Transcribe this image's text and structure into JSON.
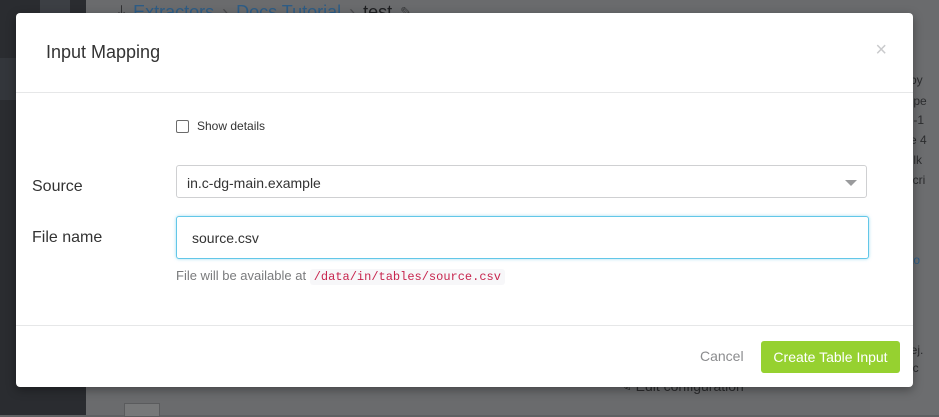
{
  "background": {
    "breadcrumb": [
      "Extractors",
      "Docs Tutorial",
      "test"
    ],
    "right_panel_fragments": [
      "d by",
      "pope",
      "02-1",
      "ate 4",
      "pelk",
      "escri",
      "e to",
      "ns",
      "drej.",
      "sec"
    ],
    "edit_configuration": "Edit configuration"
  },
  "modal": {
    "title": "Input Mapping",
    "close_glyph": "×",
    "show_details_label": "Show details",
    "show_details_checked": false,
    "source": {
      "label": "Source",
      "selected": "in.c-dg-main.example"
    },
    "file_name": {
      "label": "File name",
      "value": "source.csv"
    },
    "help": {
      "prefix": "File will be available at",
      "path": "/data/in/tables/source.csv"
    },
    "cancel_label": "Cancel",
    "create_label": "Create Table Input"
  },
  "colors": {
    "primary_button": "#96d130",
    "focus_border": "#63c7e8",
    "link": "#2e5d86",
    "code_text": "#c7254e"
  }
}
